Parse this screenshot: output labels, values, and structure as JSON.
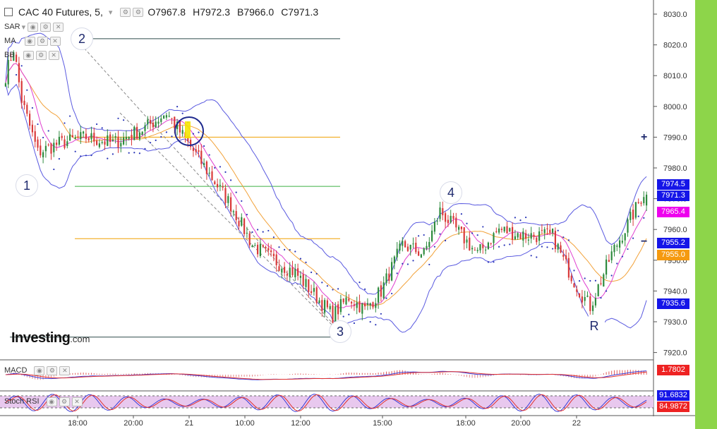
{
  "header": {
    "symbol": "CAC 40 Futures, 5,",
    "open_label": "O7967.8",
    "high_label": "H7972.3",
    "low_label": "B7966.0",
    "close_label": "C7971.3"
  },
  "indicators": {
    "sar_label": "SAR",
    "ma_label": "MA",
    "bb_label": "BB",
    "macd_label": "MACD",
    "stoch_label": "Stoch RSI"
  },
  "wave_labels": [
    "1",
    "2",
    "3",
    "4",
    "R"
  ],
  "logo": {
    "main": "Investing",
    "suffix": ".com"
  },
  "controls": {
    "zoom_in": "+",
    "zoom_out": "−"
  },
  "colors": {
    "up": "#2e8b3e",
    "down": "#d93a3a",
    "bb": "#5a5ae0",
    "ma1": "#e040d0",
    "ma2": "#f2a23a",
    "sar": "#2a36b8",
    "hline_orange": "#f0a000",
    "hline_green": "#3cb043",
    "hline_dark": "#2e4a4a",
    "sidebar": "#8dd54a"
  },
  "price_tags": [
    {
      "value": "7974.5",
      "color": "#1515e8"
    },
    {
      "value": "7971.3",
      "color": "#1515e8"
    },
    {
      "value": "7965.4",
      "color": "#ee00ee"
    },
    {
      "value": "7955.2",
      "color": "#1515e8"
    },
    {
      "value": "7955.0",
      "color": "#f59a10"
    },
    {
      "value": "7935.6",
      "color": "#1515e8"
    }
  ],
  "macd_tags": [
    {
      "value": "1.7802",
      "color": "#ee2222"
    }
  ],
  "stoch_tags": [
    {
      "value": "91.6832",
      "color": "#1515e8"
    },
    {
      "value": "84.9872",
      "color": "#ee2222"
    }
  ],
  "chart_data": {
    "type": "candlestick",
    "title": "CAC 40 Futures, 5,",
    "y_ticks": [
      "8030.0",
      "8020.0",
      "8010.0",
      "8000.0",
      "7990.0",
      "7980.0",
      "7970.0",
      "7960.0",
      "7950.0",
      "7940.0",
      "7930.0",
      "7920.0"
    ],
    "ylim": [
      7918,
      8032
    ],
    "x_ticks": [
      "18:00",
      "20:00",
      "21",
      "10:00",
      "12:00",
      "15:00",
      "18:00",
      "20:00",
      "22"
    ],
    "horizontal_levels": [
      8022,
      7990,
      7974,
      7957,
      7925
    ],
    "path_keypoints": [
      [
        0,
        8010
      ],
      [
        3,
        8019
      ],
      [
        6,
        8002
      ],
      [
        12,
        7985
      ],
      [
        20,
        7988
      ],
      [
        30,
        7990
      ],
      [
        40,
        7988
      ],
      [
        52,
        7993
      ],
      [
        60,
        7998
      ],
      [
        68,
        7988
      ],
      [
        76,
        7978
      ],
      [
        84,
        7968
      ],
      [
        92,
        7955
      ],
      [
        100,
        7950
      ],
      [
        108,
        7946
      ],
      [
        116,
        7938
      ],
      [
        122,
        7932
      ],
      [
        128,
        7938
      ],
      [
        134,
        7934
      ],
      [
        140,
        7940
      ],
      [
        148,
        7955
      ],
      [
        156,
        7952
      ],
      [
        162,
        7966
      ],
      [
        170,
        7958
      ],
      [
        176,
        7952
      ],
      [
        184,
        7960
      ],
      [
        194,
        7958
      ],
      [
        204,
        7958
      ],
      [
        208,
        7950
      ],
      [
        214,
        7940
      ],
      [
        218,
        7935
      ],
      [
        226,
        7952
      ],
      [
        234,
        7965
      ],
      [
        238,
        7972
      ]
    ],
    "last": {
      "open": 7967.8,
      "high": 7972.3,
      "low": 7966.0,
      "close": 7971.3
    }
  }
}
